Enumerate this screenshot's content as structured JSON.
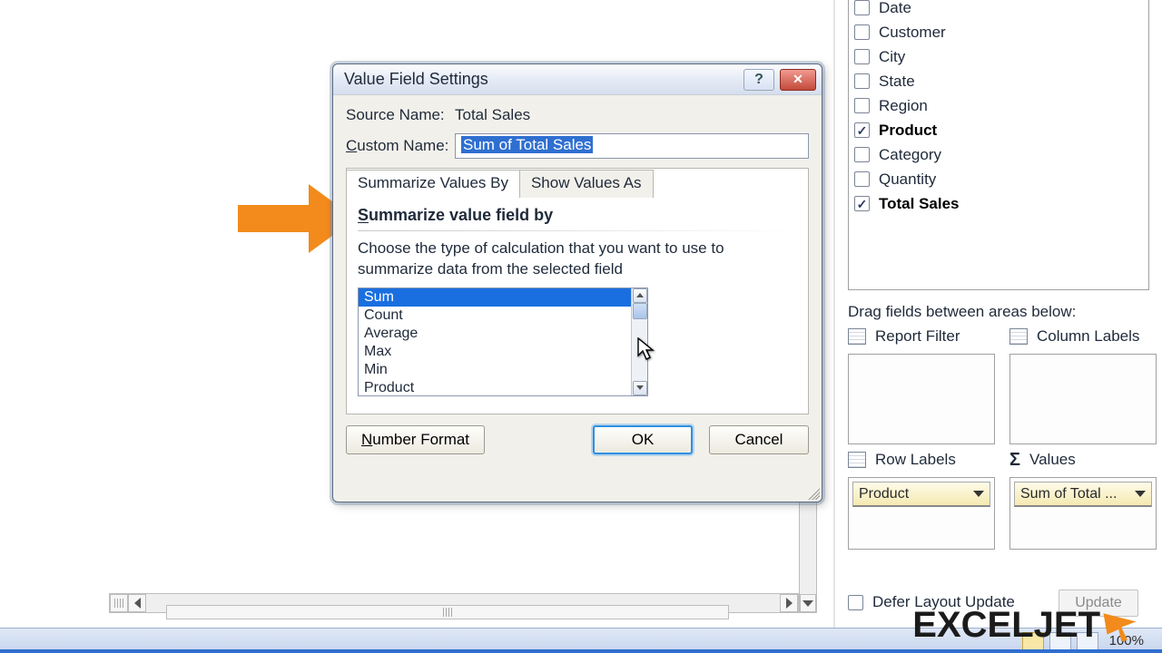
{
  "dialog": {
    "title": "Value Field Settings",
    "source_name_label": "Source Name:",
    "source_name_value": "Total Sales",
    "custom_name_label": "Custom Name:",
    "custom_name_value": "Sum of Total Sales",
    "tabs": {
      "summarize": "Summarize Values By",
      "show_as": "Show Values As"
    },
    "heading": "Summarize value field by",
    "heading_underline_char": "S",
    "description": "Choose the type of calculation that you want to use to summarize data from the selected field",
    "listbox": {
      "selected": "Sum",
      "items": [
        "Sum",
        "Count",
        "Average",
        "Max",
        "Min",
        "Product"
      ]
    },
    "number_format": "Number Format",
    "ok": "OK",
    "cancel": "Cancel"
  },
  "field_list": {
    "items": [
      {
        "label": "Date",
        "checked": false,
        "bold": false
      },
      {
        "label": "Customer",
        "checked": false,
        "bold": false
      },
      {
        "label": "City",
        "checked": false,
        "bold": false
      },
      {
        "label": "State",
        "checked": false,
        "bold": false
      },
      {
        "label": "Region",
        "checked": false,
        "bold": false
      },
      {
        "label": "Product",
        "checked": true,
        "bold": true
      },
      {
        "label": "Category",
        "checked": false,
        "bold": false
      },
      {
        "label": "Quantity",
        "checked": false,
        "bold": false
      },
      {
        "label": "Total Sales",
        "checked": true,
        "bold": true
      }
    ],
    "areas_label": "Drag fields between areas below:",
    "report_filter": "Report Filter",
    "column_labels": "Column Labels",
    "row_labels": "Row Labels",
    "values": "Values",
    "row_chip": "Product",
    "values_chip": "Sum of Total ...",
    "defer": "Defer Layout Update",
    "update": "Update"
  },
  "statusbar": {
    "zoom": "100%"
  },
  "logo": "EXCELJET"
}
